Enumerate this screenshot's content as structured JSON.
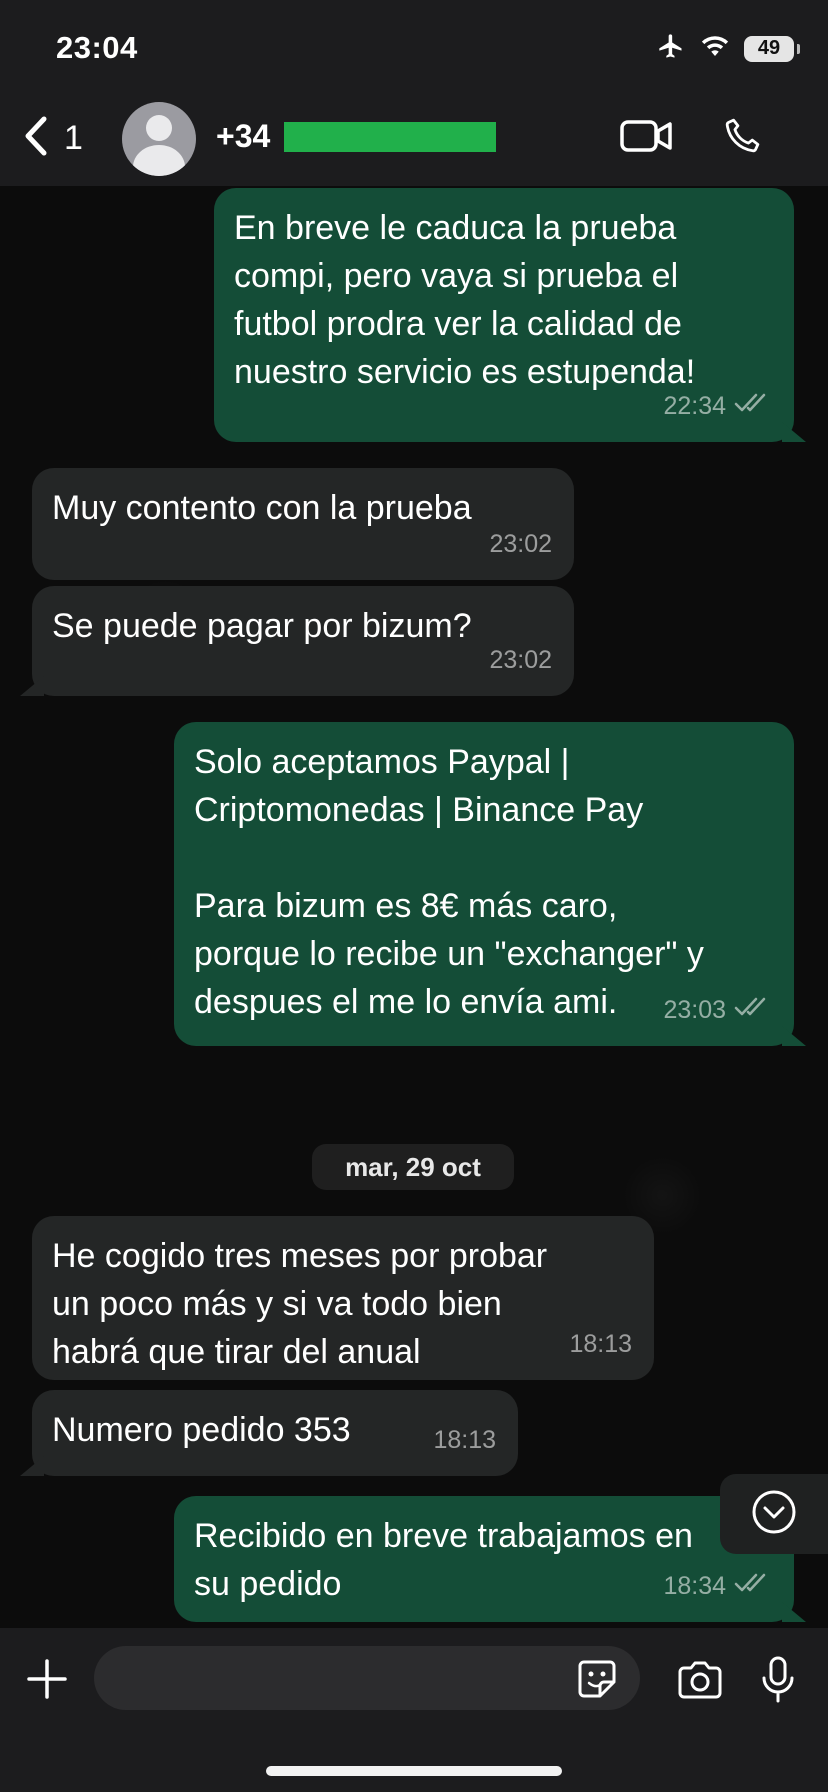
{
  "status_bar": {
    "time": "23:04",
    "battery": "49"
  },
  "header": {
    "back_count": "1",
    "phone_prefix": "+34"
  },
  "messages": [
    {
      "dir": "out",
      "text": "En breve le caduca la prueba\ncompi, pero vaya si prueba el\nfutbol prodra ver la calidad de\nnuestro servicio es estupenda!",
      "time": "22:34"
    },
    {
      "dir": "in",
      "text": "Muy contento con la prueba",
      "time": "23:02"
    },
    {
      "dir": "in",
      "text": "Se puede pagar por bizum?",
      "time": "23:02"
    },
    {
      "dir": "out",
      "text": "Solo aceptamos Paypal |\nCriptomonedas | Binance Pay\n\nPara bizum es 8€ más caro,\nporque lo recibe un \"exchanger\" y\ndespues el me lo envía ami.",
      "time": "23:03"
    },
    {
      "dir": "in",
      "text": "He cogido tres meses por probar\nun poco más y si va todo bien\nhabrá que tirar del anual",
      "time": "18:13"
    },
    {
      "dir": "in",
      "text": "Numero pedido 353",
      "time": "18:13"
    },
    {
      "dir": "out",
      "text": "Recibido en breve trabajamos en\nsu pedido",
      "time": "18:34"
    }
  ],
  "date_separator": "mar, 29 oct",
  "colors": {
    "incoming": "#242626",
    "outgoing": "#144d37",
    "redaction": "#21b04b"
  }
}
